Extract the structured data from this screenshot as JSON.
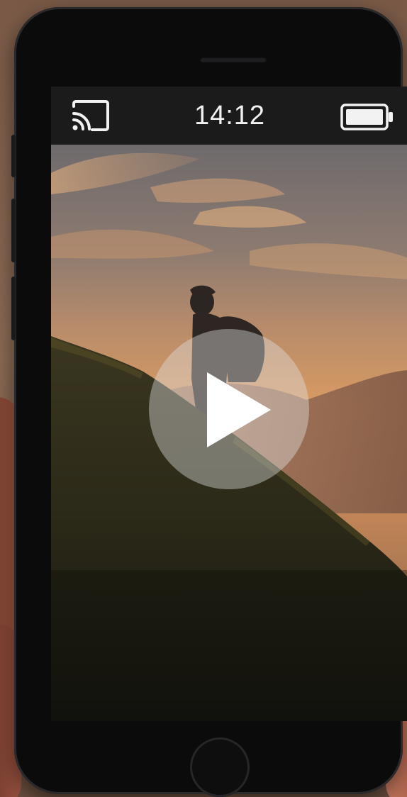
{
  "status_bar": {
    "time": "14:12",
    "cast_icon": "cast-icon",
    "battery_icon": "battery-full-icon"
  },
  "video": {
    "play_icon": "play-icon",
    "scene": "hiker-silhouette-sunset"
  },
  "device": {
    "home_button_icon": "home-button"
  },
  "colors": {
    "status_bar_bg": "#1c1b1b",
    "status_text": "#f2f2f2",
    "play_overlay": "#e1e1e1",
    "sky_top": "#6e6a6c",
    "sky_glow": "#d89a62",
    "hill": "#2b2b1a"
  }
}
